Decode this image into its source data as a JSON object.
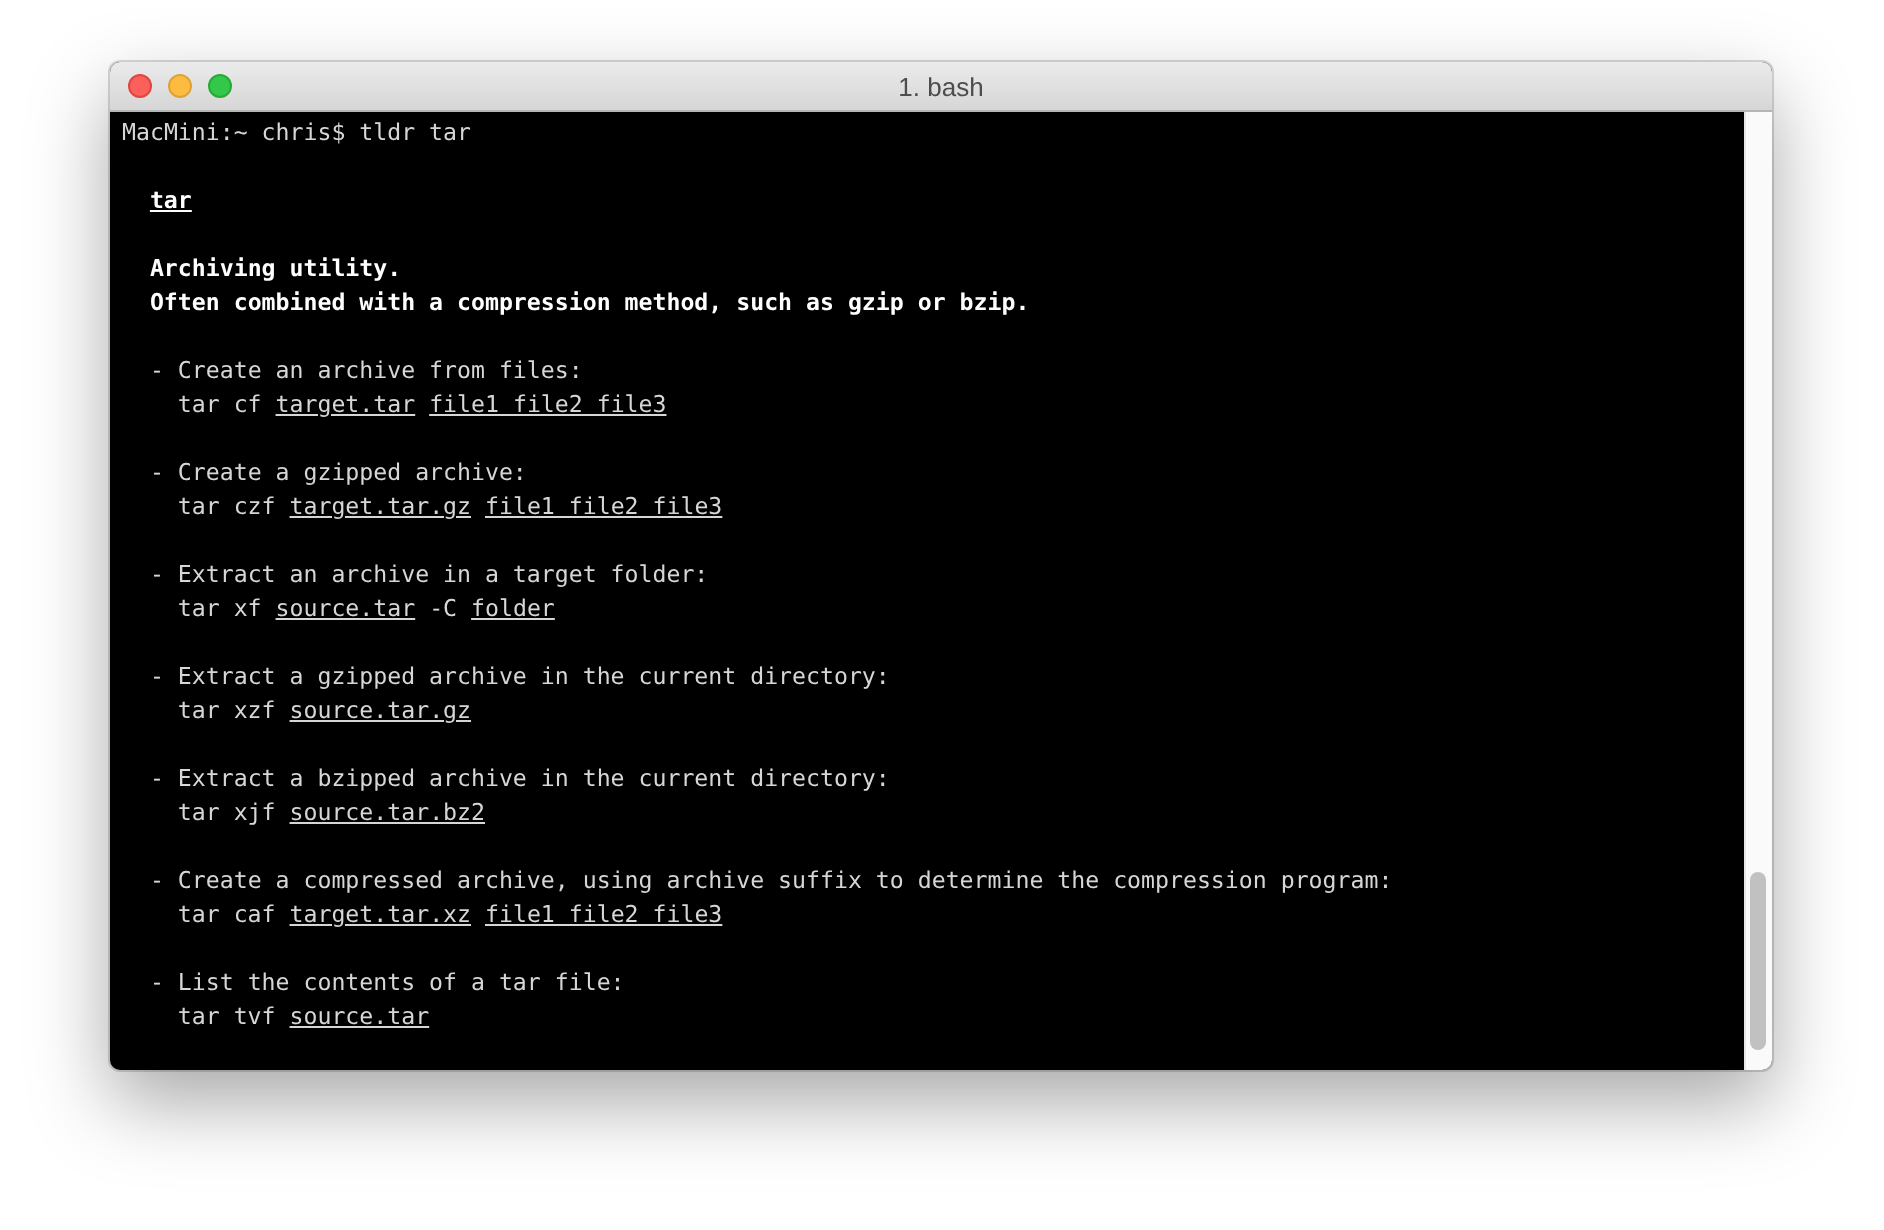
{
  "window": {
    "title": "1. bash"
  },
  "prompt": "MacMini:~ chris$ tldr tar",
  "page": {
    "title": "tar",
    "description": [
      "Archiving utility.",
      "Often combined with a compression method, such as gzip or bzip."
    ]
  },
  "examples": [
    {
      "description": "- Create an archive from files:",
      "command": [
        {
          "text": "tar cf",
          "kind": "plain"
        },
        {
          "text": "target.tar",
          "kind": "placeholder"
        },
        {
          "text": "file1 file2 file3",
          "kind": "placeholder"
        }
      ]
    },
    {
      "description": "- Create a gzipped archive:",
      "command": [
        {
          "text": "tar czf",
          "kind": "plain"
        },
        {
          "text": "target.tar.gz",
          "kind": "placeholder"
        },
        {
          "text": "file1 file2 file3",
          "kind": "placeholder"
        }
      ]
    },
    {
      "description": "- Extract an archive in a target folder:",
      "command": [
        {
          "text": "tar xf",
          "kind": "plain"
        },
        {
          "text": "source.tar",
          "kind": "placeholder"
        },
        {
          "text": "-C",
          "kind": "plain"
        },
        {
          "text": "folder",
          "kind": "placeholder"
        }
      ]
    },
    {
      "description": "- Extract a gzipped archive in the current directory:",
      "command": [
        {
          "text": "tar xzf",
          "kind": "plain"
        },
        {
          "text": "source.tar.gz",
          "kind": "placeholder"
        }
      ]
    },
    {
      "description": "- Extract a bzipped archive in the current directory:",
      "command": [
        {
          "text": "tar xjf",
          "kind": "plain"
        },
        {
          "text": "source.tar.bz2",
          "kind": "placeholder"
        }
      ]
    },
    {
      "description": "- Create a compressed archive, using archive suffix to determine the compression program:",
      "command": [
        {
          "text": "tar caf",
          "kind": "plain"
        },
        {
          "text": "target.tar.xz",
          "kind": "placeholder"
        },
        {
          "text": "file1 file2 file3",
          "kind": "placeholder"
        }
      ]
    },
    {
      "description": "- List the contents of a tar file:",
      "command": [
        {
          "text": "tar tvf",
          "kind": "plain"
        },
        {
          "text": "source.tar",
          "kind": "placeholder"
        }
      ]
    }
  ]
}
